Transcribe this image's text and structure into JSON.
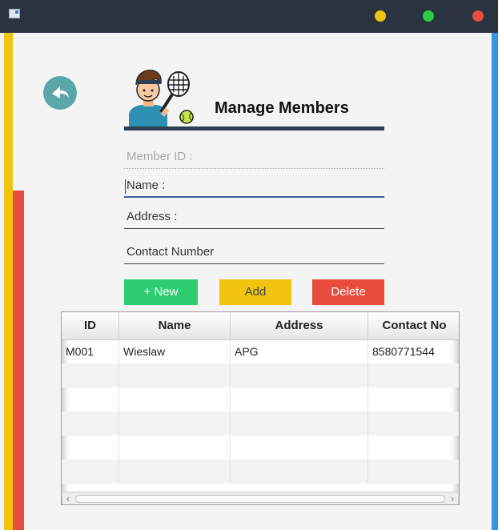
{
  "window": {
    "title": ""
  },
  "header": {
    "title": "Manage Members"
  },
  "form": {
    "member_id_placeholder": "Member ID :",
    "name_placeholder": "Name :",
    "address_placeholder": "Address :",
    "contact_placeholder": "Contact Number"
  },
  "buttons": {
    "new_label": "+ New",
    "add_label": "Add",
    "delete_label": "Delete"
  },
  "table": {
    "columns": [
      "ID",
      "Name",
      "Address",
      "Contact No"
    ],
    "rows": [
      [
        "M001",
        "Wieslaw",
        "APG",
        "8580771544"
      ],
      [
        "",
        "",
        "",
        ""
      ],
      [
        "",
        "",
        "",
        ""
      ],
      [
        "",
        "",
        "",
        ""
      ],
      [
        "",
        "",
        "",
        ""
      ],
      [
        "",
        "",
        "",
        ""
      ]
    ]
  },
  "colors": {
    "accent_yellow": "#f1c40f",
    "accent_red": "#e74c3c",
    "accent_green": "#2ecc71",
    "accent_blue": "#3498db",
    "title_bar": "#2c3340"
  },
  "icons": {
    "back": "back-arrow-icon",
    "logo": "tennis-player-icon",
    "app": "app-window-icon"
  }
}
